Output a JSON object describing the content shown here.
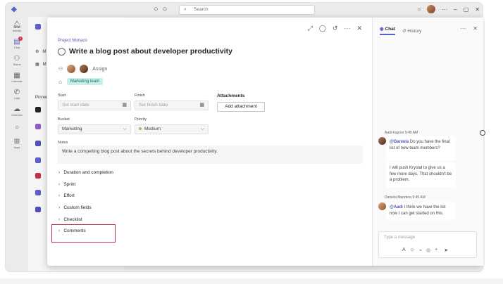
{
  "titlebar": {
    "search_placeholder": "Search"
  },
  "rail": [
    {
      "label": "Activity",
      "icon": "bell-icon"
    },
    {
      "label": "Chat",
      "icon": "chat-icon",
      "badge": "2"
    },
    {
      "label": "Teams",
      "icon": "teams-icon"
    },
    {
      "label": "Calendar",
      "icon": "calendar-icon"
    },
    {
      "label": "Calls",
      "icon": "phone-icon"
    },
    {
      "label": "OneDrive",
      "icon": "cloud-icon"
    },
    {
      "label": "Apps",
      "icon": "apps-icon"
    }
  ],
  "background": {
    "row_m1": "M",
    "row_m2": "M",
    "pinned": "Pinned"
  },
  "task": {
    "project": "Project Monaco",
    "title": "Write a blog post about developer productivity",
    "assign_label": "Assign",
    "label_tag": "Marketing team",
    "start_label": "Start",
    "start_placeholder": "Set start date",
    "finish_label": "Finish",
    "finish_placeholder": "Set finish date",
    "attachments_label": "Attachments",
    "add_attachment": "Add attachment",
    "bucket_label": "Bucket",
    "bucket_value": "Marketing",
    "priority_label": "Priority",
    "priority_value": "Medium",
    "notes_label": "Notes",
    "notes_text": "Write a compelling blog post about the secrets behind developer productivity.",
    "sections": [
      "Duration and completion",
      "Sprint",
      "Effort",
      "Custom fields",
      "Checklist",
      "Comments"
    ]
  },
  "chat": {
    "tab_chat": "Chat",
    "tab_history": "History",
    "msg1_author": "Aadi Kapoor",
    "msg1_time": "9:45 AM",
    "msg1_mention": "@Daniela",
    "msg1_text": " Do you have the final list of new team members?",
    "msg1_text2": "I will push Krystal to give us a few more days. That shouldn't be a problem.",
    "msg2_author": "Daniela Mandera",
    "msg2_time": "9:45 AM",
    "msg2_mention": "@Aadi",
    "msg2_text": " I think we have the list now I can get started on this.",
    "compose_placeholder": "Type a message"
  }
}
